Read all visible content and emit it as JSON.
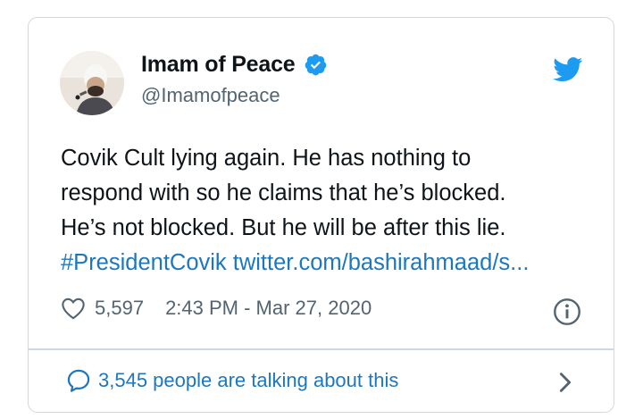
{
  "author": {
    "display_name": "Imam of Peace",
    "handle": "@Imamofpeace",
    "verified": true,
    "avatar_icon": "profile-photo"
  },
  "tweet": {
    "lines": [
      "Covik Cult lying again. He has nothing to",
      "respond with so he claims that he’s blocked.",
      "He’s not blocked. But he will be after this lie."
    ],
    "hashtag": "#PresidentCovik",
    "link_text": "twitter.com/bashirahmaad/s..."
  },
  "meta": {
    "likes": "5,597",
    "timestamp": "2:43 PM - Mar 27, 2020"
  },
  "footer": {
    "talking_text": "3,545 people are talking about this"
  },
  "colors": {
    "accent": "#1d9bf0",
    "link": "#1d77bf",
    "text": "#0f1419",
    "secondary": "#536471",
    "border": "#cfd9de"
  },
  "icons": [
    "profile-photo",
    "verified-badge-icon",
    "twitter-bird-icon",
    "heart-icon",
    "info-icon",
    "speech-bubble-icon",
    "chevron-right-icon"
  ]
}
